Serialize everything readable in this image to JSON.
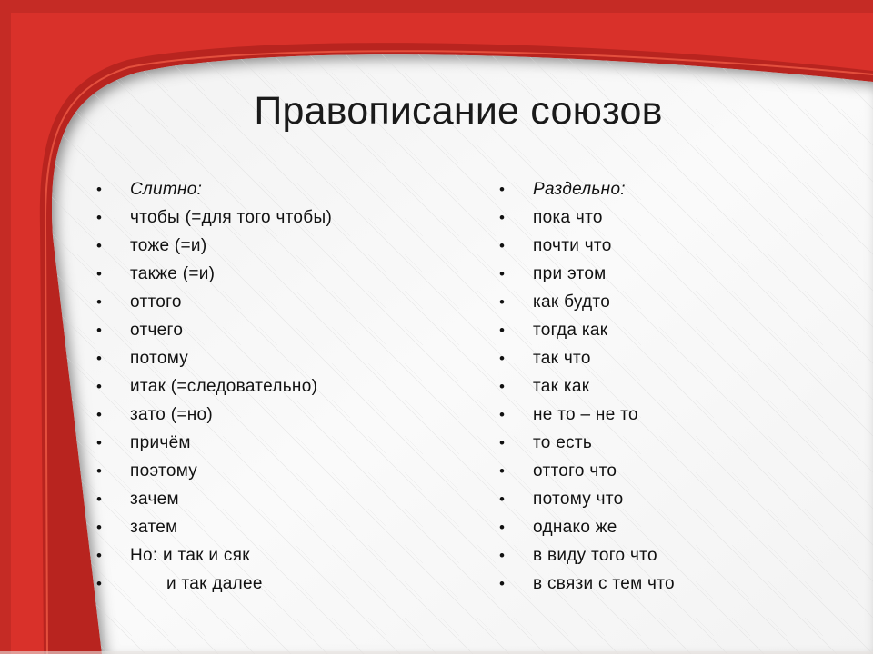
{
  "slide": {
    "title": "Правописание союзов",
    "colors": {
      "frame_red": "#d9312a",
      "frame_dark": "#b8241f",
      "frame_light": "#ec4a3a",
      "paper": "#f6f6f6",
      "text": "#111111"
    },
    "bullet_glyph": "•",
    "left_column": {
      "heading": "Слитно:",
      "items": [
        "чтобы (=для того чтобы)",
        "тоже (=и)",
        "также (=и)",
        "оттого",
        "отчего",
        "потому",
        "итак (=следовательно)",
        "зато (=но)",
        "причём",
        "поэтому",
        "зачем",
        "затем",
        "Но: и так и сяк",
        "и так далее"
      ]
    },
    "right_column": {
      "heading": "Раздельно:",
      "items": [
        "пока что",
        "почти что",
        "при этом",
        "как будто",
        "тогда как",
        "так что",
        "так как",
        "не то – не то",
        "то есть",
        "оттого что",
        "потому что",
        "однако же",
        "в виду того что",
        "в связи с тем что"
      ]
    }
  }
}
